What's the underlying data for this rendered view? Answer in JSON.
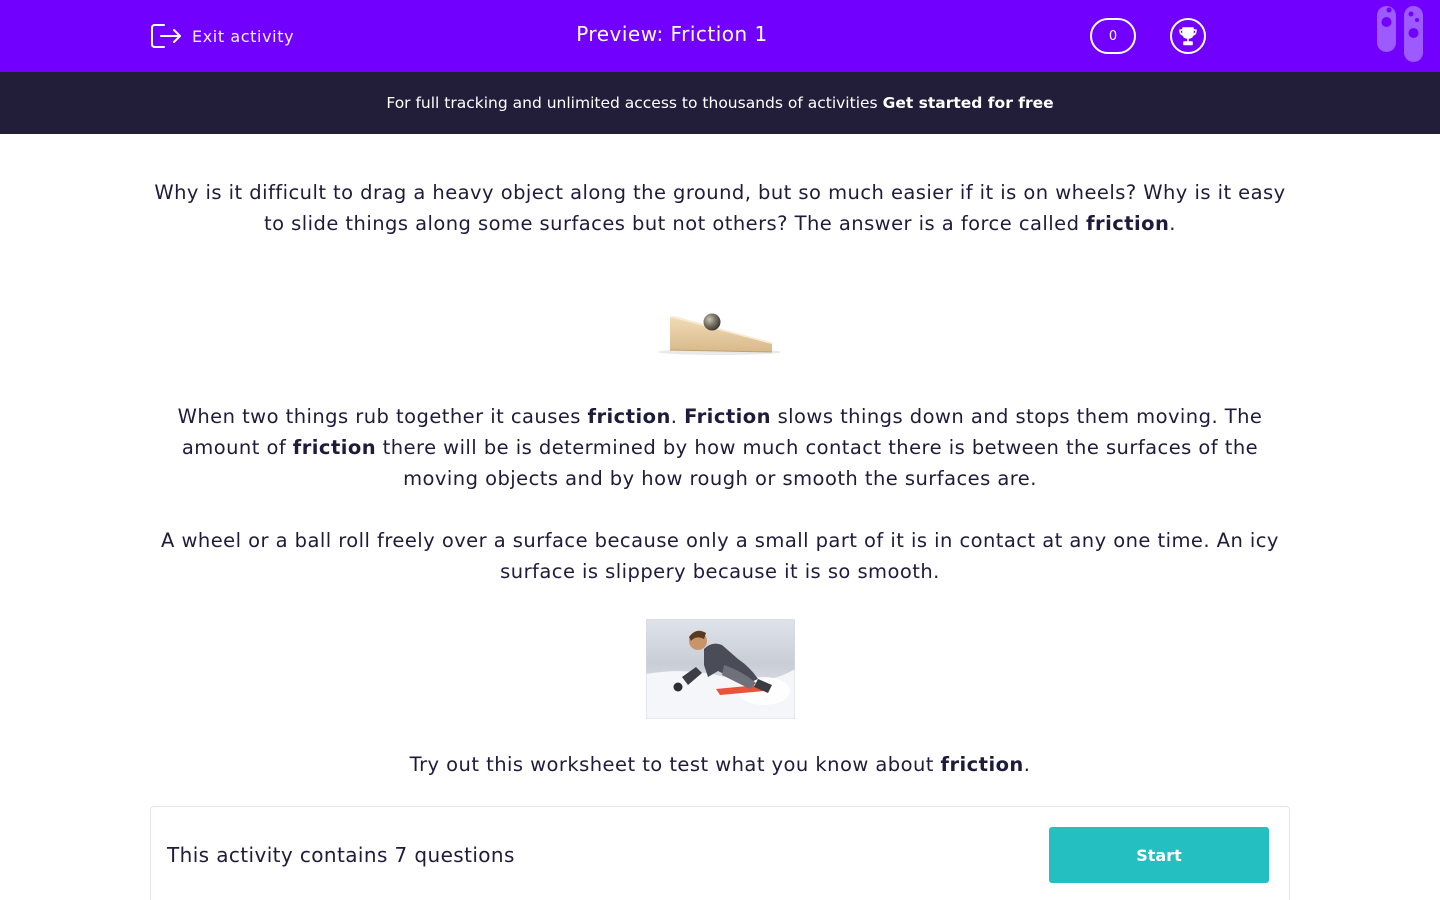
{
  "header": {
    "exit_label": "Exit activity",
    "title": "Preview: Friction 1",
    "score": "0"
  },
  "promo": {
    "text": "For full tracking and unlimited access to thousands of activities",
    "link": "Get started for free"
  },
  "content": {
    "p1": {
      "text": "Why is it difficult to drag a heavy object along the ground, but so much easier if it is on wheels? Why is it easy to slide things along some surfaces but not others? The answer is a force called ",
      "bold": "friction",
      "end": "."
    },
    "p2": {
      "a": "When two things rub together it causes ",
      "b1": "friction",
      "c": ". ",
      "b2": "Friction",
      "d": " slows things down and stops them moving. The amount of ",
      "b3": "friction",
      "e": " there will be is determined by how much contact there is between the surfaces of the moving objects and by how rough or smooth the surfaces are."
    },
    "p3": "A wheel or a ball roll freely over a surface because only a small part of it is in contact at any one time. An icy surface is slippery because it is so smooth.",
    "p4": {
      "text": "Try out this worksheet to test what you know about ",
      "bold": "friction",
      "end": "."
    }
  },
  "activity": {
    "summary": "This activity contains 7 questions",
    "start_label": "Start"
  },
  "colors": {
    "topbar": "#7100ff",
    "promo_bg": "#221d38",
    "start_button": "#24bfc1",
    "text": "#1f1b3a"
  }
}
